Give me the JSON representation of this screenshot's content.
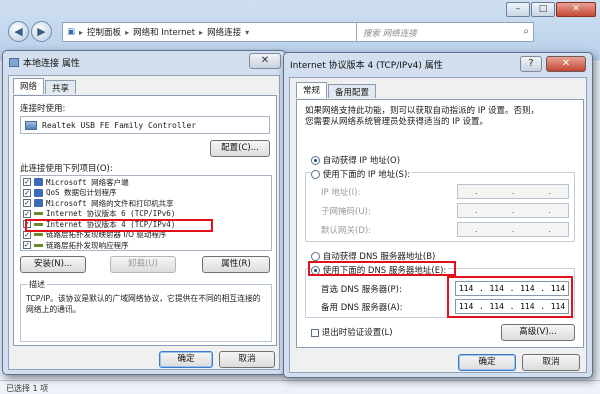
{
  "explorer": {
    "breadcrumb": [
      "控制面板",
      "网络和 Internet",
      "网络连接"
    ],
    "search_placeholder": "搜索 网络连接",
    "status": "已选择 1 项"
  },
  "left_dialog": {
    "title": "本地连接 属性",
    "tabs": [
      "网络",
      "共享"
    ],
    "connect_using_label": "连接时使用:",
    "adapter": "Realtek USB FE Family Controller",
    "configure_button": "配置(C)...",
    "items_label": "此连接使用下列项目(O):",
    "items": [
      {
        "label": "Microsoft 网络客户端",
        "checked": true,
        "icon_color": "#3a6db5"
      },
      {
        "label": "QoS 数据包计划程序",
        "checked": true,
        "icon_color": "#3a6db5"
      },
      {
        "label": "Microsoft 网络的文件和打印机共享",
        "checked": true,
        "icon_color": "#3a6db5"
      },
      {
        "label": "Internet 协议版本 6 (TCP/IPv6)",
        "checked": true,
        "icon_color": "#6a8a2f"
      },
      {
        "label": "Internet 协议版本 4 (TCP/IPv4)",
        "checked": true,
        "icon_color": "#6a8a2f"
      },
      {
        "label": "链路层拓扑发现映射器 I/O 驱动程序",
        "checked": true,
        "icon_color": "#6a8a2f"
      },
      {
        "label": "链路层拓扑发现响应程序",
        "checked": true,
        "icon_color": "#6a8a2f"
      }
    ],
    "install_button": "安装(N)...",
    "uninstall_button": "卸载(U)",
    "properties_button": "属性(R)",
    "description_title": "描述",
    "description_text": "TCP/IP。该协议是默认的广域网络协议，它提供在不同的相互连接的网络上的通讯。",
    "ok_button": "确定",
    "cancel_button": "取消"
  },
  "right_dialog": {
    "title": "Internet 协议版本 4 (TCP/IPv4) 属性",
    "tabs": [
      "常规",
      "备用配置"
    ],
    "intro": "如果网络支持此功能，则可以获取自动指派的 IP 设置。否则，您需要从网络系统管理员处获得适当的 IP 设置。",
    "auto_ip": "自动获得 IP 地址(O)",
    "manual_ip": "使用下面的 IP 地址(S):",
    "ip_label": "IP 地址(I):",
    "subnet_label": "子网掩码(U):",
    "gateway_label": "默认网关(D):",
    "auto_dns": "自动获得 DNS 服务器地址(B)",
    "manual_dns": "使用下面的 DNS 服务器地址(E):",
    "preferred_dns_label": "首选 DNS 服务器(P):",
    "alternate_dns_label": "备用 DNS 服务器(A):",
    "preferred_dns": [
      "114",
      "114",
      "114",
      "114"
    ],
    "alternate_dns": [
      "114",
      "114",
      "114",
      "114"
    ],
    "validate_label": "退出时验证设置(L)",
    "advanced_button": "高级(V)...",
    "ok_button": "确定",
    "cancel_button": "取消"
  },
  "colors": {
    "highlight": "#e2101b",
    "accent": "#3b79c6"
  }
}
